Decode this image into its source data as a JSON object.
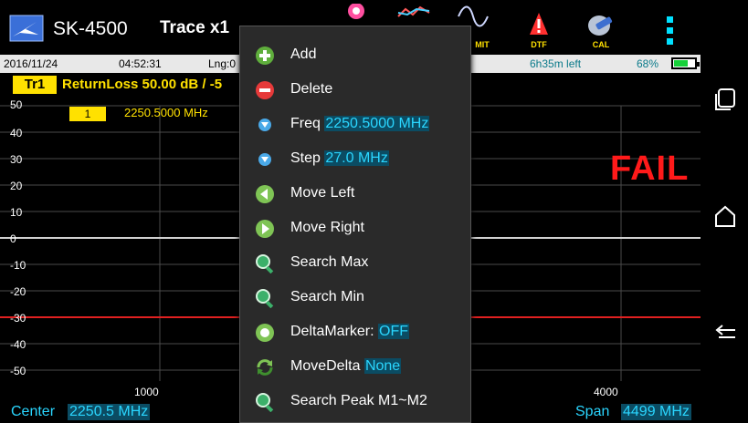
{
  "app": {
    "title": "SK-4500",
    "trace_button": "Trace x1"
  },
  "toolbar": {
    "limit_label": "MIT",
    "dtf_label": "DTF",
    "cal_label": "CAL"
  },
  "status": {
    "date": "2016/11/24",
    "time": "04:52:31",
    "lng": "Lng:0",
    "time_left": "6h35m left",
    "battery_pct": "68%",
    "battery_level": 0.68
  },
  "trace": {
    "badge": "Tr1",
    "info": "ReturnLoss 50.00 dB / -5"
  },
  "graph": {
    "y_ticks": [
      "50",
      "40",
      "30",
      "20",
      "10",
      "0",
      "-10",
      "-20",
      "-30",
      "-40",
      "-50"
    ],
    "x_ticks": [
      "1000",
      "4000"
    ],
    "marker_number": "1",
    "marker_freq": "2250.5000 MHz",
    "fail_text": "FAIL",
    "limit_line_db": -30,
    "trace_level_db": 0
  },
  "bottom": {
    "center_label": "Center",
    "center_value": "2250.5 MHz",
    "span_label": "Span",
    "span_value": "4499 MHz"
  },
  "menu": {
    "add": "Add",
    "delete": "Delete",
    "freq_label": "Freq",
    "freq_value": "2250.5000 MHz",
    "step_label": "Step",
    "step_value": "27.0 MHz",
    "move_left": "Move Left",
    "move_right": "Move Right",
    "search_max": "Search Max",
    "search_min": "Search Min",
    "delta_label": "DeltaMarker:",
    "delta_value": "OFF",
    "movedelta_label": "MoveDelta",
    "movedelta_value": "None",
    "search_peak": "Search Peak M1~M2"
  },
  "colors": {
    "accent_yellow": "#ffe100",
    "value_cyan": "#2ad6ff",
    "fail_red": "#ff1a1a",
    "limit_line": "#e02020"
  }
}
